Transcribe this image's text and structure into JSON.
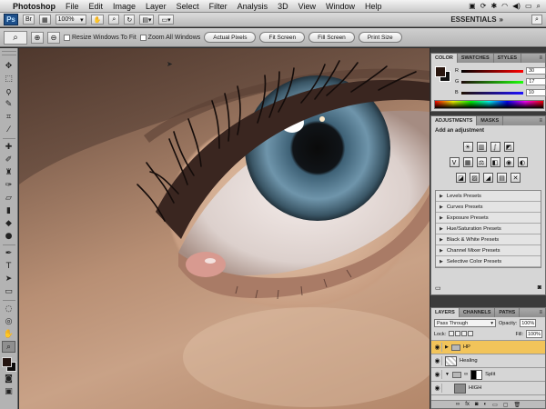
{
  "menubar": {
    "apple": "",
    "app_name": "Photoshop",
    "items": [
      "File",
      "Edit",
      "Image",
      "Layer",
      "Select",
      "Filter",
      "Analysis",
      "3D",
      "View",
      "Window",
      "Help"
    ]
  },
  "appbar": {
    "logo": "Ps",
    "zoom": "100%",
    "workspace": "ESSENTIALS"
  },
  "options": {
    "resize_windows": "Resize Windows To Fit",
    "zoom_all": "Zoom All Windows",
    "actual_pixels": "Actual Pixels",
    "fit_screen": "Fit Screen",
    "fill_screen": "Fill Screen",
    "print_size": "Print Size"
  },
  "color_panel": {
    "tabs": [
      "COLOR",
      "SWATCHES",
      "STYLES"
    ],
    "r": {
      "label": "R",
      "value": "30"
    },
    "g": {
      "label": "G",
      "value": "17"
    },
    "b": {
      "label": "B",
      "value": "10"
    },
    "foreground": "#2a1710",
    "background": "#111111"
  },
  "adjustments": {
    "tabs": [
      "ADJUSTMENTS",
      "MASKS"
    ],
    "title": "Add an adjustment",
    "presets": [
      "Levels Presets",
      "Curves Presets",
      "Exposure Presets",
      "Hue/Saturation Presets",
      "Black & White Presets",
      "Channel Mixer Presets",
      "Selective Color Presets"
    ]
  },
  "layers_panel": {
    "tabs": [
      "LAYERS",
      "CHANNELS",
      "PATHS"
    ],
    "blend_mode": "Pass Through",
    "opacity_label": "Opacity:",
    "opacity": "100%",
    "lock_label": "Lock:",
    "fill_label": "Fill:",
    "fill": "100%",
    "layers": [
      {
        "name": "HP",
        "type": "group",
        "selected": true
      },
      {
        "name": "Healing",
        "type": "layer",
        "selected": false
      },
      {
        "name": "Split",
        "type": "group",
        "selected": false
      },
      {
        "name": "HIGH",
        "type": "layer",
        "selected": false
      }
    ]
  },
  "accent": "#f2c45a"
}
